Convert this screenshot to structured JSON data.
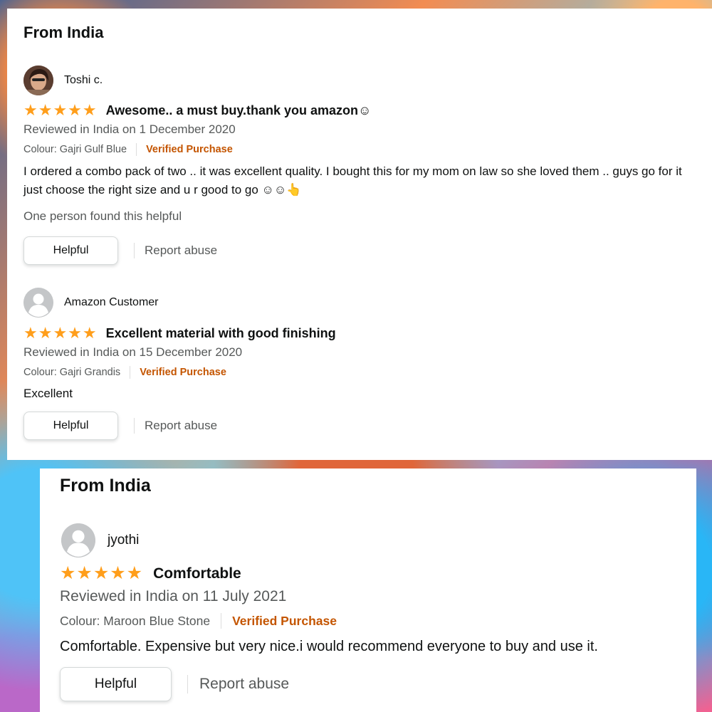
{
  "panels": [
    {
      "heading": "From India",
      "reviews": [
        {
          "name": "Toshi c.",
          "rating": 5,
          "stars": "★★★★★",
          "title": "Awesome.. a must buy.thank you amazon☺",
          "date": "Reviewed in India on 1 December 2020",
          "colour": "Colour: Gajri Gulf Blue",
          "verified": "Verified Purchase",
          "body": "I ordered a combo pack of two .. it was excellent quality. I bought this for my mom on law so she loved them .. guys go for it just choose the right size and u r good to go ☺☺👆",
          "helpful_count": "One person found this helpful",
          "helpful_label": "Helpful",
          "report_label": "Report abuse"
        },
        {
          "name": "Amazon Customer",
          "rating": 5,
          "stars": "★★★★★",
          "title": "Excellent material with good finishing",
          "date": "Reviewed in India on 15 December 2020",
          "colour": "Colour: Gajri Grandis",
          "verified": "Verified Purchase",
          "body": "Excellent",
          "helpful_label": "Helpful",
          "report_label": "Report abuse"
        }
      ]
    },
    {
      "heading": "From India",
      "reviews": [
        {
          "name": "jyothi",
          "rating": 5,
          "stars": "★★★★★",
          "title": "Comfortable",
          "date": "Reviewed in India on 11 July 2021",
          "colour": "Colour: Maroon Blue Stone",
          "verified": "Verified Purchase",
          "body": "Comfortable. Expensive but very nice.i would recommend everyone to buy and use it.",
          "helpful_label": "Helpful",
          "report_label": "Report abuse"
        }
      ]
    }
  ],
  "colors": {
    "star": "#ff9e1b",
    "verified": "#c45500",
    "secondary_text": "#565959"
  }
}
